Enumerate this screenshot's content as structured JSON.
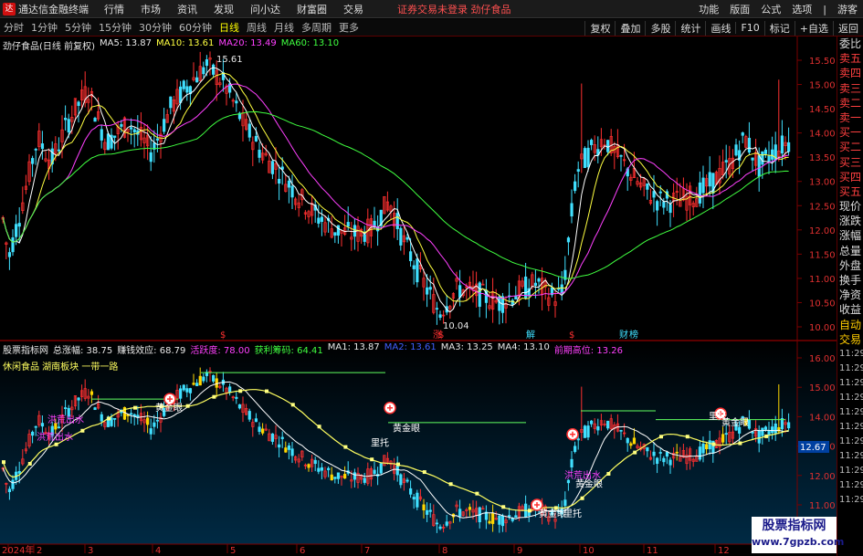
{
  "menubar": {
    "logo": "达",
    "app_name": "通达信金融终端",
    "menus": [
      "行情",
      "市场",
      "资讯",
      "发现",
      "问小达",
      "财富圈",
      "交易"
    ],
    "notice": "证券交易未登录   劲仔食品",
    "right_items": [
      "功能",
      "版面",
      "公式",
      "选项",
      "|",
      "游客"
    ]
  },
  "toolbar": {
    "periods": [
      "分时",
      "1分钟",
      "5分钟",
      "15分钟",
      "30分钟",
      "60分钟",
      "日线",
      "周线",
      "月线",
      "多周期",
      "更多"
    ],
    "active_period": "日线",
    "right_items": [
      "复权",
      "叠加",
      "多股",
      "统计",
      "画线",
      "F10",
      "标记",
      "+自选",
      "返回"
    ]
  },
  "upper_info": {
    "title": "劲仔食品(日线 前复权)",
    "ma5": "MA5: 13.87",
    "ma10": "MA10: 13.61",
    "ma20": "MA20: 13.49",
    "ma60": "MA60: 13.10",
    "high_label": "15.61",
    "low_label": "10.04"
  },
  "price_axis": [
    "15.50",
    "15.00",
    "14.50",
    "14.00",
    "13.50",
    "13.00",
    "12.50",
    "12.00",
    "11.50",
    "11.00",
    "10.50",
    "10.00"
  ],
  "lower_axis": [
    "16.00",
    "15.00",
    "14.00",
    "13.00",
    "12.00",
    "11.00"
  ],
  "lower_current": "12.67",
  "event_labels": [
    "$",
    "涨",
    "$",
    "解",
    "$",
    "财",
    "榜"
  ],
  "lower_info": {
    "name": "股票指标网",
    "items": [
      {
        "text": "总涨幅: 38.75",
        "color": "#e8e8e8"
      },
      {
        "text": "赚钱效应: 68.79",
        "color": "#e8e8e8"
      },
      {
        "text": "活跃度: 78.00",
        "color": "#ff40ff"
      },
      {
        "text": "获利筹码: 64.41",
        "color": "#40ff40"
      },
      {
        "text": "MA1: 13.87",
        "color": "#e8e8e8"
      },
      {
        "text": "MA2: 13.61",
        "color": "#4060ff"
      },
      {
        "text": "MA3: 13.25",
        "color": "#e8e8e8"
      },
      {
        "text": "MA4: 13.10",
        "color": "#e8e8e8"
      },
      {
        "text": "前期高位: 13.26",
        "color": "#ff40ff"
      }
    ],
    "subtitle": "休闲食品 湖南板块 一带一路"
  },
  "signals": {
    "gold_eye": "黄金眼",
    "support": "里托",
    "flood": "洪荒出水"
  },
  "x_axis": [
    "2024年",
    "2",
    "3",
    "4",
    "5",
    "6",
    "7",
    "8",
    "9",
    "10",
    "11",
    "12"
  ],
  "side_panel": {
    "items": [
      "委比",
      "卖五",
      "卖四",
      "卖三",
      "卖二",
      "卖一",
      "买一",
      "买二",
      "买三",
      "买四",
      "买五",
      "现价",
      "涨跌",
      "涨幅",
      "总量",
      "外盘",
      "换手",
      "净资",
      "收益"
    ],
    "trade_items": [
      "自动",
      "交易"
    ],
    "times": [
      "11:29",
      "11:29",
      "11:29",
      "11:29",
      "11:29",
      "11:29",
      "11:29",
      "11:29",
      "11:29",
      "11:29",
      "11:29"
    ]
  },
  "watermark": {
    "line1": "股票指标网",
    "line2": "www.7gpzb.com"
  },
  "colors": {
    "up": "#ff3030",
    "down": "#40e0ff",
    "ma5": "#ffffff",
    "ma10": "#ffff40",
    "ma20": "#ff40ff",
    "ma60": "#40ff40",
    "gold": "#ffd700"
  }
}
